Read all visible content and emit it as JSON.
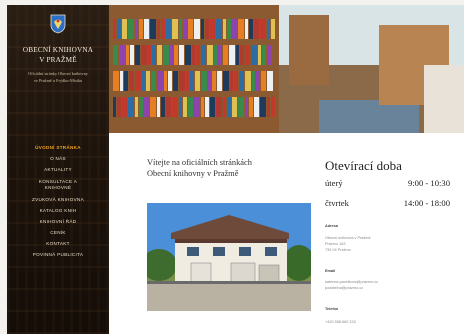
{
  "sidebar": {
    "title_line1": "OBECNÍ KNIHOVNA",
    "title_line2": "V PRAŽMĚ",
    "subtitle_line1": "Oficiální stránky Obecní knihovny",
    "subtitle_line2": "ve Pražmě u Frýdku-Místku",
    "nav": [
      {
        "label": "ÚVODNÍ STRÁNKA",
        "active": true
      },
      {
        "label": "O NÁS"
      },
      {
        "label": "AKTUALITY"
      },
      {
        "label": "KONSULTACE A\nKNIHOVNÉ"
      },
      {
        "label": "ZVUKOVÁ KNIHOVNA"
      },
      {
        "label": "KATALOG KNIH"
      },
      {
        "label": "KNIHOVNÍ ŘÁD"
      },
      {
        "label": "CENÍK"
      },
      {
        "label": "KONTAKT"
      },
      {
        "label": "POVINNÁ PUBLICITA"
      }
    ]
  },
  "main": {
    "welcome_line1": "Vítejte na oficiálních stránkách",
    "welcome_line2": "Obecní knihovny v Pražmě"
  },
  "hours": {
    "title": "Otevírací doba",
    "rows": [
      {
        "day": "úterý",
        "time": "9:00 - 10:30"
      },
      {
        "day": "čtvrtek",
        "time": "14:00 - 18:00"
      }
    ]
  },
  "contact": {
    "address_label": "Adresa",
    "address_lines": [
      "Obecní knihovna v Pražmě",
      "Pražmo 163",
      "739 04 Pražmo"
    ],
    "email_label": "Email",
    "email_lines": [
      "katerina.pavelkova@prazmo.cz",
      "podatelna@prazmo.cz"
    ],
    "phone_label": "Telefon",
    "phone": "+420 558 660 233"
  },
  "colors": {
    "accent": "#f0a31f",
    "sidebar_bg": "#1c130c"
  },
  "icons": {
    "crest": "coat-of-arms-icon"
  }
}
